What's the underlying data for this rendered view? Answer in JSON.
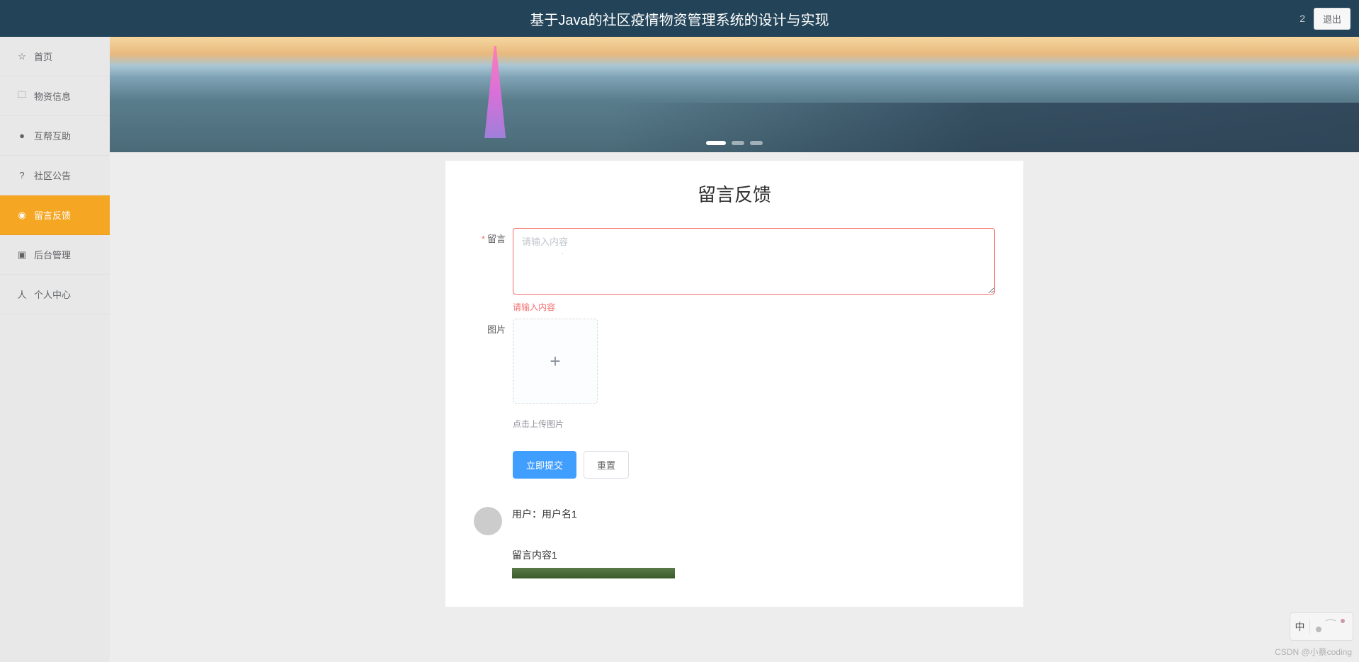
{
  "header": {
    "title": "基于Java的社区疫情物资管理系统的设计与实现",
    "count": "2",
    "logout": "退出"
  },
  "sidebar": {
    "items": [
      {
        "icon": "☆",
        "label": "首页"
      },
      {
        "icon": "🗀",
        "label": "物资信息"
      },
      {
        "icon": "●",
        "label": "互帮互助"
      },
      {
        "icon": "?",
        "label": "社区公告"
      },
      {
        "icon": "◉",
        "label": "留言反馈"
      },
      {
        "icon": "▣",
        "label": "后台管理"
      },
      {
        "icon": "人",
        "label": "个人中心"
      }
    ],
    "active_index": 4
  },
  "card": {
    "title": "留言反馈",
    "form": {
      "message_label": "留言",
      "message_placeholder": "请输入内容",
      "message_error": "请输入内容",
      "image_label": "图片",
      "upload_hint": "点击上传图片",
      "submit": "立即提交",
      "reset": "重置"
    }
  },
  "comments": [
    {
      "user_label": "用户：用户名1",
      "content": "留言内容1"
    }
  ],
  "ime": {
    "lang": "中"
  },
  "watermark": "CSDN @小蔡coding"
}
